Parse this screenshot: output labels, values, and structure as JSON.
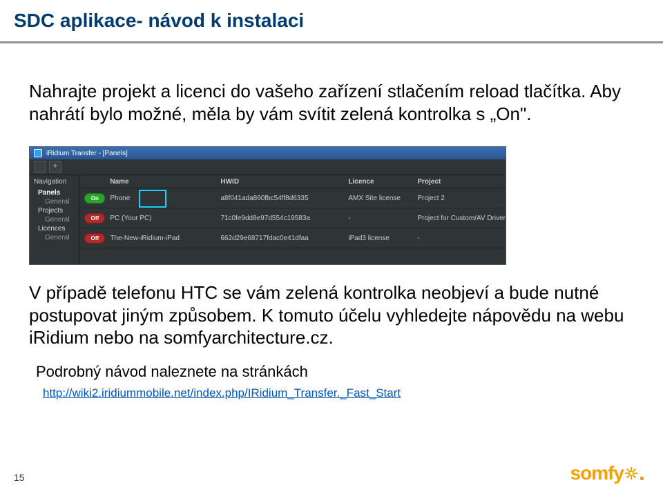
{
  "title": "SDC aplikace- návod k instalaci",
  "paragraphs": {
    "p1": "Nahrajte projekt a licenci do vašeho zařízení stlačením reload tlačítka. Aby nahrátí bylo možné, měla by vám svítit zelená kontrolka s „On\".",
    "p2": "V případě telefonu HTC se vám zelená kontrolka neobjeví a bude nutné postupovat jiným způsobem. K tomuto účelu vyhledejte nápovědu na webu iRidium nebo na somfyarchitecture.cz.",
    "p3": "Podrobný návod naleznete na stránkách"
  },
  "link_text": "http://wiki2.iridiummobile.net/index.php/IRidium_Transfer._Fast_Start",
  "trailing_dot": ".",
  "page_number": "15",
  "logo_text": "somfy",
  "screenshot": {
    "window_title": "iRidium Transfer - [Panels]",
    "nav_label": "Navigation",
    "nav": {
      "panels": "Panels",
      "general1": "General",
      "projects": "Projects",
      "general2": "General",
      "licences": "Licences",
      "general3": "General"
    },
    "columns": {
      "name": "Name",
      "hwid": "HWID",
      "licence": "Licence",
      "project": "Project"
    },
    "pill_on": "On",
    "pill_off": "Off",
    "rows": [
      {
        "status": "on",
        "status_key": "pill_on",
        "name": "Phone",
        "hwid": "a8f041ada860fbc54ff8d6335",
        "lic": "AMX Site license",
        "proj": "Project 2"
      },
      {
        "status": "off",
        "status_key": "pill_off",
        "name": "PC (Your PC)",
        "hwid": "71c0fe9dd8e97d554c19583a",
        "lic": "-",
        "proj": "Project for Custom/AV Driver"
      },
      {
        "status": "off",
        "status_key": "pill_off",
        "name": "The-New-iRidium-iPad",
        "hwid": "662d29e68717fdac0e41dfaa",
        "lic": "iPad3 license",
        "proj": "-"
      }
    ]
  }
}
